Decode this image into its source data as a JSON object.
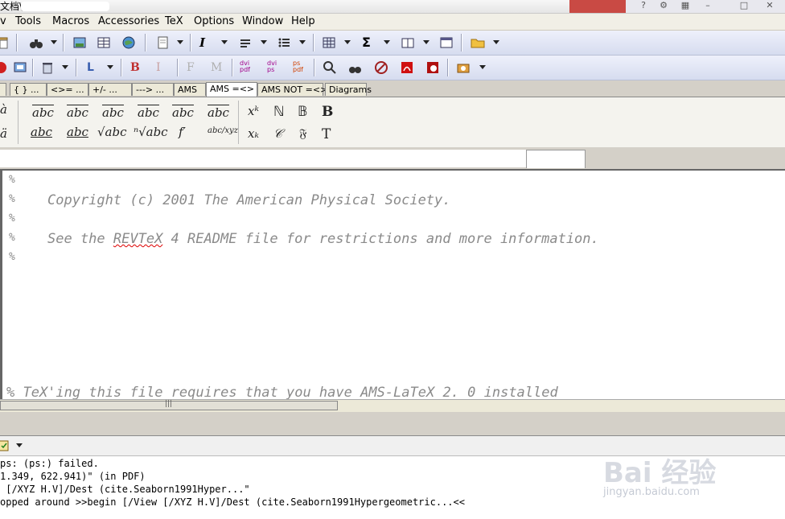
{
  "window": {
    "title": "文档\\"
  },
  "menu": [
    "v",
    "Tools",
    "Macros",
    "Accessories",
    "TeX",
    "Options",
    "Window",
    "Help"
  ],
  "toolbar2": {
    "bold": "B",
    "italic": "I",
    "font": "F",
    "math": "M",
    "latex": "L",
    "dvi_pdf": "dvi pdf",
    "dvi_ps": "dvi ps",
    "ps_pdf": "ps pdf"
  },
  "symbol_tabs": [
    "{ } ...",
    "<>= ...",
    "+/- ...",
    "---> ...",
    "AMS",
    "AMS =<>",
    "AMS NOT =<>",
    "Diagrams"
  ],
  "symbols": {
    "row1": [
      "abc",
      "abc",
      "abc",
      "abc",
      "abc",
      "abc",
      "xᵏ",
      "ℕ",
      "𝔹",
      "B"
    ],
    "row2": [
      "abc",
      "abc",
      "√abc",
      "ⁿ√abc",
      "f′",
      "abc/xyz",
      "xₖ",
      "𝒞",
      "𝔉",
      "T"
    ],
    "left": [
      "à",
      "ä"
    ]
  },
  "editor": {
    "lines": [
      "%",
      "%   Copyright (c) 2001 The American Physical Society.",
      "%",
      "%   See the REVTeX 4 README file for restrictions and more information.",
      "%"
    ],
    "copyright": "Copyright (c) 2001 The American Physical Society.",
    "see_pre": "See the ",
    "revtex": "REVTeX",
    "see_post": " 4 README file for restrictions and more information.",
    "bottom_line": "% TeX'ing this file requires that you have AMS-LaTeX 2. 0 installed"
  },
  "output": {
    "lines": [
      "ps: (ps:) failed.",
      "1.349, 622.941)\" (in PDF)",
      " [/XYZ H.V]/Dest (cite.Seaborn1991Hyper...\"",
      "opped around >>begin [/View [/XYZ H.V]/Dest (cite.Seaborn1991Hypergeometric...<<"
    ]
  },
  "watermark": {
    "brand": "Bai 经验",
    "url": "jingyan.baidu.com"
  }
}
